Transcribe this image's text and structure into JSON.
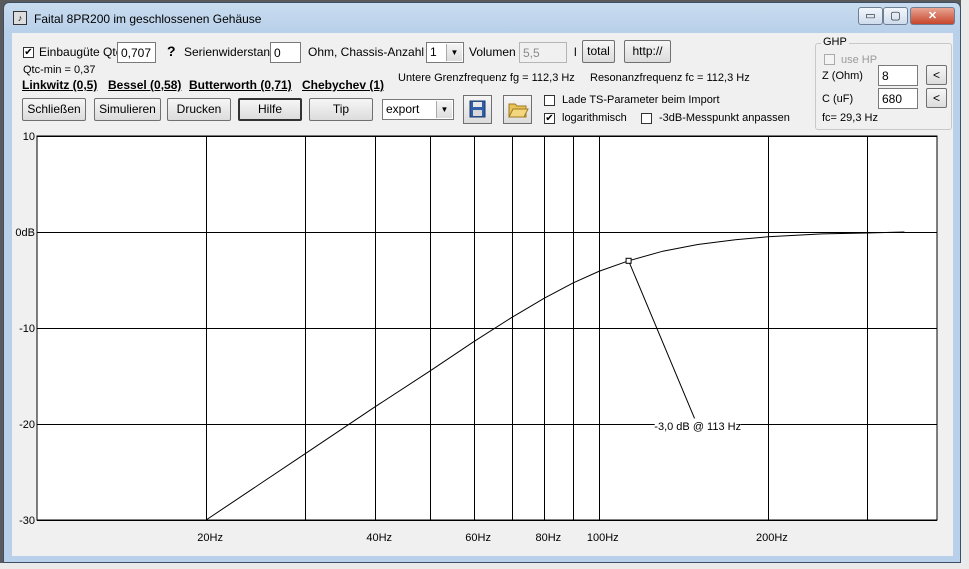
{
  "window": {
    "title": "Faital 8PR200 im geschlossenen Gehäuse",
    "min_label": "▭",
    "max_label": "▢",
    "close_label": "✕"
  },
  "toolbar": {
    "einbauguete_label": "Einbaugüte Qtc",
    "einbauguete_checked": true,
    "qtc_value": "0,707",
    "help_symbol": "?",
    "serienwiderstand_label": "Serienwiderstand",
    "serienwiderstand_value": "0",
    "ohm_chassis_label": "Ohm, Chassis-Anzahl",
    "chassis_count": "1",
    "volumen_label": "Volumen",
    "volumen_value": "5,5",
    "volumen_unit": "l",
    "total_label": "total",
    "http_label": "http://",
    "qtc_min": "Qtc-min = 0,37",
    "presets": [
      "Linkwitz (0,5)",
      "Bessel (0,58)",
      "Butterworth (0,71)",
      "Chebychev (1)"
    ],
    "untere_grenzfrequenz": "Untere Grenzfrequenz fg = 112,3 Hz",
    "resonanzfrequenz": "Resonanzfrequenz fc = 112,3 Hz",
    "schliessen_label": "Schließen",
    "simulieren_label": "Simulieren",
    "drucken_label": "Drucken",
    "hilfe_label": "Hilfe",
    "tip_label": "Tip",
    "export_value": "export",
    "lade_ts_label": "Lade TS-Parameter beim Import",
    "lade_ts_checked": false,
    "logarithmisch_label": "logarithmisch",
    "logarithmisch_checked": true,
    "messpunkt_label": "-3dB-Messpunkt anpassen",
    "messpunkt_checked": false
  },
  "ghp": {
    "title": "GHP",
    "use_hp_label": "use HP",
    "z_label": "Z (Ohm)",
    "z_value": "8",
    "c_label": "C (uF)",
    "c_value": "680",
    "arrow_label": "<",
    "fc_text": "fc= 29,3 Hz"
  },
  "chart_data": {
    "type": "line",
    "x_scale": "log",
    "xlim": [
      10,
      400
    ],
    "ylim": [
      -30,
      10
    ],
    "x_ticks": [
      20,
      40,
      60,
      80,
      100,
      200
    ],
    "x_tick_labels": [
      "20Hz",
      "40Hz",
      "60Hz",
      "80Hz",
      "100Hz",
      "200Hz"
    ],
    "x_gridlines": [
      10,
      20,
      30,
      40,
      50,
      60,
      70,
      80,
      90,
      100,
      200,
      300,
      400
    ],
    "y_ticks": [
      10,
      0,
      -10,
      -20,
      -30
    ],
    "y_tick_labels": [
      "10",
      "0dB",
      "-10",
      "-20",
      "-30"
    ],
    "grid": true,
    "series": [
      {
        "x": [
          20,
          25,
          30,
          40,
          50,
          60,
          70,
          80,
          90,
          100,
          113,
          130,
          150,
          175,
          200,
          250,
          300,
          350
        ],
        "y": [
          -30.0,
          -26.2,
          -23.1,
          -18.2,
          -14.5,
          -11.4,
          -8.9,
          -6.9,
          -5.3,
          -4.1,
          -3.0,
          -2.0,
          -1.3,
          -0.8,
          -0.5,
          -0.2,
          -0.1,
          0.0
        ],
        "color": "#000000"
      }
    ],
    "marker": {
      "x": 113,
      "y": -3.0,
      "label": "-3,0 dB @ 113 Hz",
      "label_x": 150,
      "label_y": -20.2
    }
  }
}
